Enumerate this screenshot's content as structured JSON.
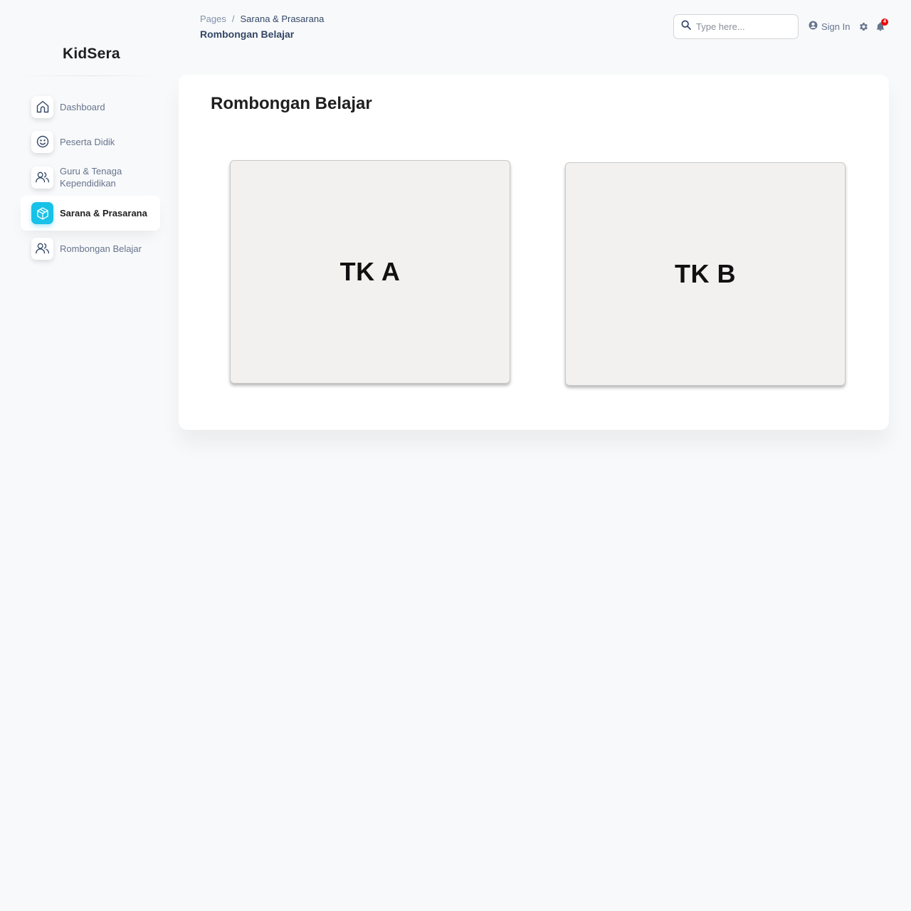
{
  "brand": {
    "name": "KidSera"
  },
  "sidebar": {
    "items": [
      {
        "label": "Dashboard",
        "icon": "home-icon",
        "active": false
      },
      {
        "label": "Peserta Didik",
        "icon": "smile-icon",
        "active": false
      },
      {
        "label": "Guru & Tenaga Kependidikan",
        "icon": "users-icon",
        "active": false
      },
      {
        "label": "Sarana & Prasarana",
        "icon": "box-icon",
        "active": true
      },
      {
        "label": "Rombongan Belajar",
        "icon": "users-icon",
        "active": false
      }
    ]
  },
  "header": {
    "breadcrumb": {
      "root": "Pages",
      "separator": "/",
      "current": "Sarana & Prasarana"
    },
    "title": "Rombongan Belajar",
    "search": {
      "placeholder": "Type here...",
      "value": ""
    },
    "signin_label": "Sign In",
    "notification_count": "4"
  },
  "main": {
    "title": "Rombongan Belajar",
    "classes": [
      {
        "label": "TK A"
      },
      {
        "label": "TK B"
      }
    ]
  },
  "colors": {
    "accent": "#17c1e8",
    "text_primary": "#344767",
    "text_secondary": "#67748e",
    "badge": "#ea0606",
    "background": "#f8f9fa",
    "class_box": "#f3f0f0"
  }
}
